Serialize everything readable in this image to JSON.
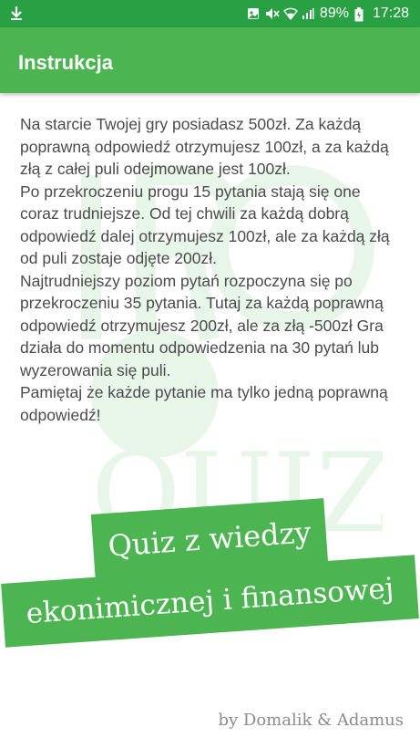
{
  "status_bar": {
    "battery": "89%",
    "time": "17:28",
    "icons": [
      "download-icon",
      "image-icon",
      "mute-icon",
      "wifi-icon",
      "signal-icon",
      "battery-icon"
    ]
  },
  "app_bar": {
    "title": "Instrukcja"
  },
  "instructions": {
    "paragraphs": [
      "Na starcie Twojej gry posiadasz 500zł. Za każdą poprawną odpowiedź otrzymujesz 100zł, a za każdą złą z całej puli odejmowane jest 100zł.",
      "Po przekroczeniu progu 15 pytania stają się one coraz trudniejsze. Od tej chwili za każdą dobrą odpowiedź dalej otrzymujesz 100zł, ale za każdą złą od puli zostaje odjęte 200zł.",
      "Najtrudniejszy poziom pytań rozpoczyna się po przekroczeniu 35 pytania. Tutaj za każdą poprawną odpowiedź otrzymujesz 200zł, ale za złą -500zł Gra działa do momentu odpowiedzenia na 30 pytań lub wyzerowania się puli.",
      "Pamiętaj że każde pytanie ma tylko jedną poprawną odpowiedź!"
    ]
  },
  "banner": {
    "line1": "Quiz z wiedzy",
    "line2": "ekonimicznej i finansowej"
  },
  "watermark_text": "QUIZ",
  "credits": "by Domalik & Adamus",
  "colors": {
    "status_bar": "#29a043",
    "app_bar": "#4cb552",
    "banner": "#4cb552",
    "text": "#4b4b4b",
    "credits": "#8c8c8c"
  }
}
